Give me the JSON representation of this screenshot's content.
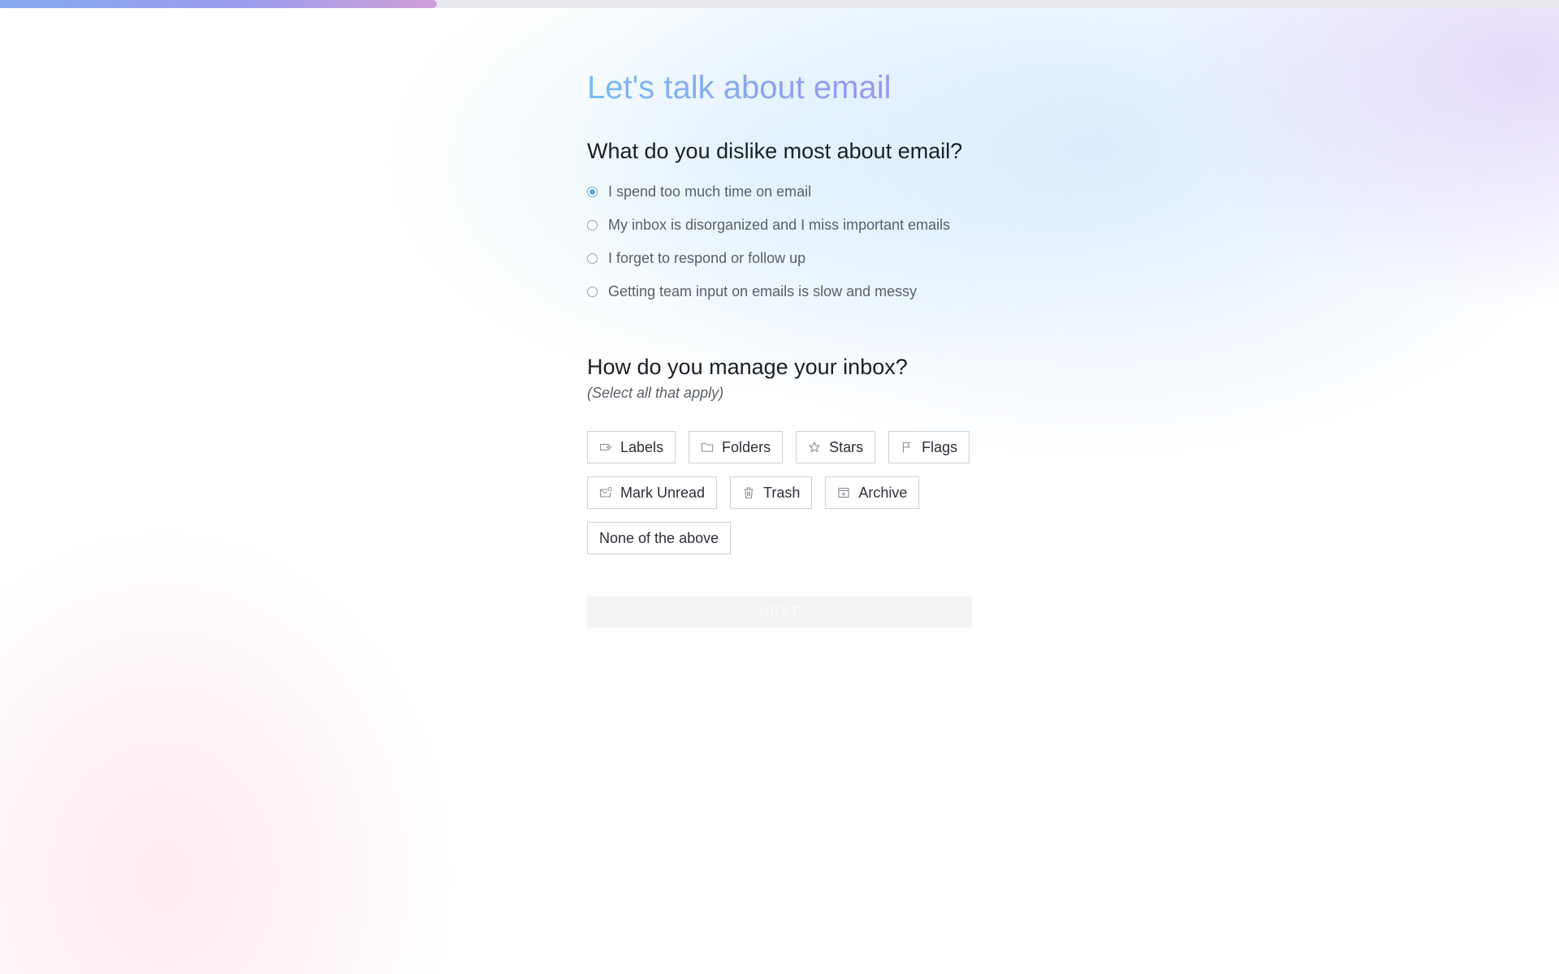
{
  "progress": {
    "fraction": 0.28
  },
  "header": {
    "title": "Let's talk about email"
  },
  "question1": {
    "title": "What do you dislike most about email?",
    "options": [
      {
        "label": "I spend too much time on email",
        "selected": true
      },
      {
        "label": "My inbox is disorganized and I miss important emails",
        "selected": false
      },
      {
        "label": "I forget to respond or follow up",
        "selected": false
      },
      {
        "label": "Getting team input on emails is slow and messy",
        "selected": false
      }
    ]
  },
  "question2": {
    "title": "How do you manage your inbox?",
    "subtitle": "(Select all that apply)",
    "options": [
      {
        "label": "Labels",
        "icon": "label-icon"
      },
      {
        "label": "Folders",
        "icon": "folder-icon"
      },
      {
        "label": "Stars",
        "icon": "star-icon"
      },
      {
        "label": "Flags",
        "icon": "flag-icon"
      },
      {
        "label": "Mark Unread",
        "icon": "mark-unread-icon"
      },
      {
        "label": "Trash",
        "icon": "trash-icon"
      },
      {
        "label": "Archive",
        "icon": "archive-icon"
      },
      {
        "label": "None of the above",
        "icon": null
      }
    ]
  },
  "next_button": {
    "label": "NEXT",
    "enabled": false
  },
  "colors": {
    "accent": "#5ba2d8",
    "title_gradient_start": "#79bbee",
    "title_gradient_end": "#9b95ea",
    "progress_start": "#86a8ee",
    "progress_end": "#cf9fd8"
  }
}
